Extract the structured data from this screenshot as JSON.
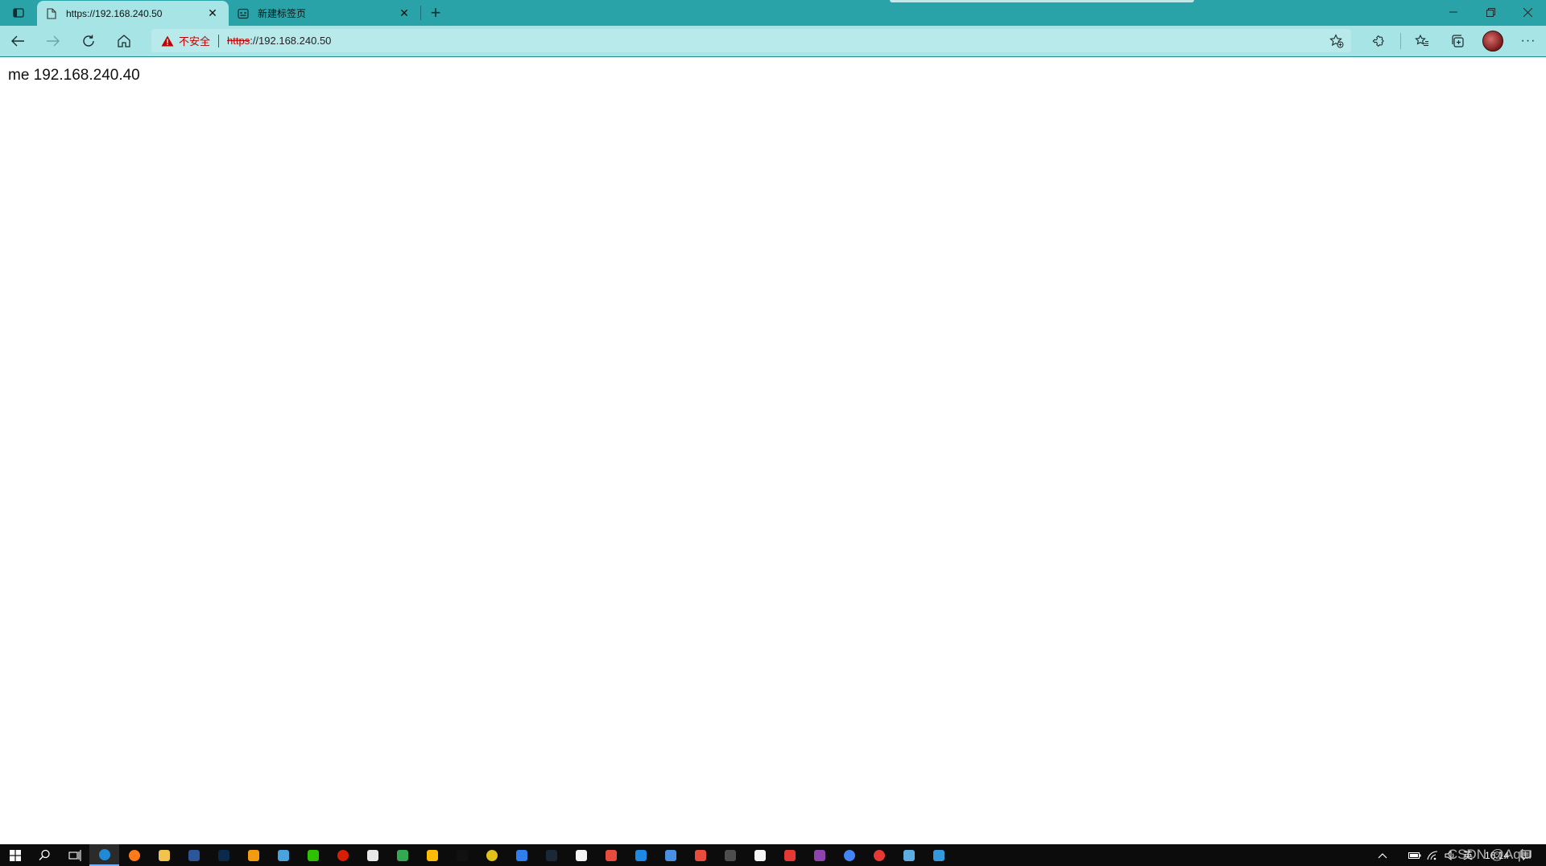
{
  "browser": {
    "tabs": [
      {
        "title": "https://192.168.240.50",
        "active": true
      },
      {
        "title": "新建标签页",
        "active": false
      }
    ],
    "addressbar": {
      "security_label": "不安全",
      "url_scheme": "https",
      "url_rest": "://192.168.240.50"
    }
  },
  "page": {
    "text": "me 192.168.240.40"
  },
  "taskbar": {
    "ime": "英",
    "clock": "16:14",
    "apps": [
      {
        "name": "edge",
        "color": "#1f8bd6"
      },
      {
        "name": "firefox",
        "color": "#ff7a18"
      },
      {
        "name": "file-explorer",
        "color": "#f2c44d"
      },
      {
        "name": "word",
        "color": "#2b579a"
      },
      {
        "name": "photoshop",
        "color": "#0a2a4a"
      },
      {
        "name": "app-orange-square",
        "color": "#f39c12"
      },
      {
        "name": "remote-desktop",
        "color": "#4aa3df"
      },
      {
        "name": "wechat",
        "color": "#2dc100"
      },
      {
        "name": "netease-music",
        "color": "#d81e06"
      },
      {
        "name": "app-white-square",
        "color": "#e8e8e8"
      },
      {
        "name": "play-store",
        "color": "#34a853"
      },
      {
        "name": "chrome-like",
        "color": "#fbbc05"
      },
      {
        "name": "qq",
        "color": "#111111"
      },
      {
        "name": "app-yellow-circle",
        "color": "#e0c21a"
      },
      {
        "name": "app-blue-wave",
        "color": "#2f80ed"
      },
      {
        "name": "steam",
        "color": "#1b2838"
      },
      {
        "name": "notepad",
        "color": "#f5f5f5"
      },
      {
        "name": "app-multicolor",
        "color": "#e74c3c"
      },
      {
        "name": "vs-code-insiders",
        "color": "#1e88e5"
      },
      {
        "name": "v2ray",
        "color": "#4a90e2"
      },
      {
        "name": "xshell",
        "color": "#e74c3c"
      },
      {
        "name": "gns3",
        "color": "#4d4d4d"
      },
      {
        "name": "typora",
        "color": "#f5f5f5"
      },
      {
        "name": "xmind",
        "color": "#e53935"
      },
      {
        "name": "winrar",
        "color": "#8e44ad"
      },
      {
        "name": "chromium",
        "color": "#4285f4"
      },
      {
        "name": "screen-recorder",
        "color": "#e53935"
      },
      {
        "name": "rdp-manager",
        "color": "#5dade2"
      },
      {
        "name": "app-blue-window",
        "color": "#3498db"
      }
    ]
  },
  "watermark": "CSDN @Aqiu"
}
